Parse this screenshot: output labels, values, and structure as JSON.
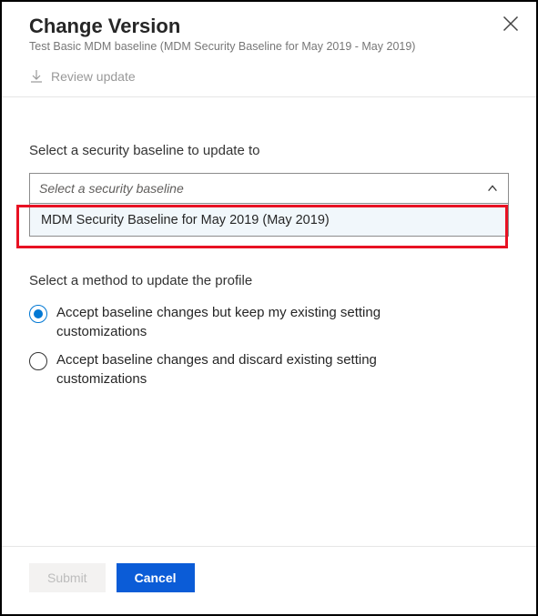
{
  "header": {
    "title": "Change Version",
    "subtitle": "Test Basic MDM baseline (MDM Security Baseline for May 2019 - May 2019)"
  },
  "toolbar": {
    "review_label": "Review update"
  },
  "baseline": {
    "section_label": "Select a security baseline to update to",
    "placeholder": "Select a security baseline",
    "option": "MDM Security Baseline for May 2019 (May 2019)"
  },
  "method": {
    "section_label": "Select a method to update the profile",
    "options": [
      "Accept baseline changes but keep my existing setting customizations",
      "Accept baseline changes and discard existing setting customizations"
    ],
    "selected_index": 0
  },
  "footer": {
    "submit": "Submit",
    "cancel": "Cancel"
  },
  "colors": {
    "accent": "#0078d4",
    "primary_button": "#0b5cd7",
    "highlight": "#e81123"
  }
}
